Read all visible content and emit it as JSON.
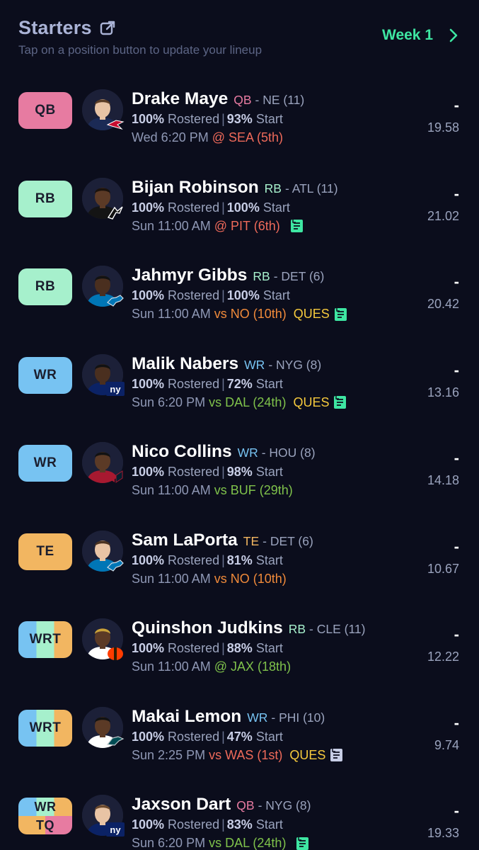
{
  "header": {
    "title": "Starters",
    "subtitle": "Tap on a position button to update your lineup",
    "week_label": "Week 1",
    "icons": {
      "share": "external-link-icon",
      "next": "chevron-right-icon"
    }
  },
  "colors": {
    "background": "#0b0d1c",
    "accent": "#3ee6a2",
    "QB": "#e77ba1",
    "RB": "#a6f0cc",
    "WR": "#77c3f2",
    "TE": "#f2b661",
    "TQ": "#e77ba1",
    "opp_bad": "#ef6a5a",
    "opp_mid": "#f08a3a",
    "opp_good": "#7fc24b",
    "ques": "#f5c93d"
  },
  "players": [
    {
      "slot": "QB",
      "slot_bg": [
        "#e77ba1"
      ],
      "name": "Drake Maye",
      "pos": "QB",
      "team_rank": "- NE (11)",
      "rostered": "100%",
      "rostered_label": "Rostered",
      "start": "93%",
      "start_label": "Start",
      "game_time": "Wed 6:20 PM",
      "opponent": "@ SEA (5th)",
      "opp_color": "#ef6a5a",
      "status": "",
      "note": false,
      "note_color": "",
      "dash": "-",
      "projection": "19.58",
      "logo": "patriots-logo-icon",
      "jersey": "#1b2a55",
      "skin": "#e8c4a5",
      "hair": "#5a3d26"
    },
    {
      "slot": "RB",
      "slot_bg": [
        "#a6f0cc"
      ],
      "name": "Bijan Robinson",
      "pos": "RB",
      "team_rank": "- ATL (11)",
      "rostered": "100%",
      "rostered_label": "Rostered",
      "start": "100%",
      "start_label": "Start",
      "game_time": "Sun 11:00 AM",
      "opponent": "@ PIT (6th)",
      "opp_color": "#ef6a5a",
      "status": "",
      "note": true,
      "note_color": "#3ee6a2",
      "dash": "-",
      "projection": "21.02",
      "logo": "falcons-logo-icon",
      "jersey": "#141414",
      "skin": "#5b3a26",
      "hair": "#1b120c"
    },
    {
      "slot": "RB",
      "slot_bg": [
        "#a6f0cc"
      ],
      "name": "Jahmyr Gibbs",
      "pos": "RB",
      "team_rank": "- DET (6)",
      "rostered": "100%",
      "rostered_label": "Rostered",
      "start": "100%",
      "start_label": "Start",
      "game_time": "Sun 11:00 AM",
      "opponent": "vs NO (10th)",
      "opp_color": "#f08a3a",
      "status": "QUES",
      "note": true,
      "note_color": "#3ee6a2",
      "dash": "-",
      "projection": "20.42",
      "logo": "lions-logo-icon",
      "jersey": "#0076b6",
      "skin": "#4a2f1f",
      "hair": "#121212"
    },
    {
      "slot": "WR",
      "slot_bg": [
        "#77c3f2"
      ],
      "name": "Malik Nabers",
      "pos": "WR",
      "team_rank": "- NYG (8)",
      "rostered": "100%",
      "rostered_label": "Rostered",
      "start": "72%",
      "start_label": "Start",
      "game_time": "Sun 6:20 PM",
      "opponent": "vs DAL (24th)",
      "opp_color": "#7fc24b",
      "status": "QUES",
      "note": true,
      "note_color": "#3ee6a2",
      "dash": "-",
      "projection": "13.16",
      "logo": "giants-logo-icon",
      "jersey": "#0b2265",
      "skin": "#4a2f1f",
      "hair": "#121212"
    },
    {
      "slot": "WR",
      "slot_bg": [
        "#77c3f2"
      ],
      "name": "Nico Collins",
      "pos": "WR",
      "team_rank": "- HOU (8)",
      "rostered": "100%",
      "rostered_label": "Rostered",
      "start": "98%",
      "start_label": "Start",
      "game_time": "Sun 11:00 AM",
      "opponent": "vs BUF (29th)",
      "opp_color": "#7fc24b",
      "status": "",
      "note": false,
      "note_color": "",
      "dash": "-",
      "projection": "14.18",
      "logo": "texans-logo-icon",
      "jersey": "#a71930",
      "skin": "#5b3a26",
      "hair": "#121212"
    },
    {
      "slot": "TE",
      "slot_bg": [
        "#f2b661"
      ],
      "name": "Sam LaPorta",
      "pos": "TE",
      "team_rank": "- DET (6)",
      "rostered": "100%",
      "rostered_label": "Rostered",
      "start": "81%",
      "start_label": "Start",
      "game_time": "Sun 11:00 AM",
      "opponent": "vs NO (10th)",
      "opp_color": "#f08a3a",
      "status": "",
      "note": false,
      "note_color": "",
      "dash": "-",
      "projection": "10.67",
      "logo": "lions-logo-icon",
      "jersey": "#0076b6",
      "skin": "#e8c4a5",
      "hair": "#4a3322"
    },
    {
      "slot": "WRT",
      "slot_bg": [
        "#77c3f2",
        "#a6f0cc",
        "#f2b661"
      ],
      "name": "Quinshon Judkins",
      "pos": "RB",
      "team_rank": "- CLE (11)",
      "rostered": "100%",
      "rostered_label": "Rostered",
      "start": "88%",
      "start_label": "Start",
      "game_time": "Sun 11:00 AM",
      "opponent": "@ JAX (18th)",
      "opp_color": "#7fc24b",
      "status": "",
      "note": false,
      "note_color": "",
      "dash": "-",
      "projection": "12.22",
      "logo": "browns-logo-icon",
      "jersey": "#ffffff",
      "skin": "#5b3a26",
      "hair": "#c9a23a"
    },
    {
      "slot": "WRT",
      "slot_bg": [
        "#77c3f2",
        "#a6f0cc",
        "#f2b661"
      ],
      "name": "Makai Lemon",
      "pos": "WR",
      "team_rank": "- PHI (10)",
      "rostered": "100%",
      "rostered_label": "Rostered",
      "start": "47%",
      "start_label": "Start",
      "game_time": "Sun 2:25 PM",
      "opponent": "vs WAS (1st)",
      "opp_color": "#ef6a5a",
      "status": "QUES",
      "note": true,
      "note_color": "#c8cee6",
      "dash": "-",
      "projection": "9.74",
      "logo": "eagles-logo-icon",
      "jersey": "#ffffff",
      "skin": "#5b3a26",
      "hair": "#121212"
    },
    {
      "slot": "WR/TQ",
      "slot_bg": [
        "#77c3f2",
        "#a6f0cc",
        "#f2b661",
        "#e77ba1"
      ],
      "slot_top": "WR",
      "slot_bottom": "TQ",
      "name": "Jaxson Dart",
      "pos": "QB",
      "team_rank": "- NYG (8)",
      "rostered": "100%",
      "rostered_label": "Rostered",
      "start": "83%",
      "start_label": "Start",
      "game_time": "Sun 6:20 PM",
      "opponent": "vs DAL (24th)",
      "opp_color": "#7fc24b",
      "status": "",
      "note": true,
      "note_color": "#3ee6a2",
      "dash": "-",
      "projection": "19.33",
      "logo": "giants-logo-icon",
      "jersey": "#0b2265",
      "skin": "#e8c4a5",
      "hair": "#6b4a2e"
    }
  ]
}
